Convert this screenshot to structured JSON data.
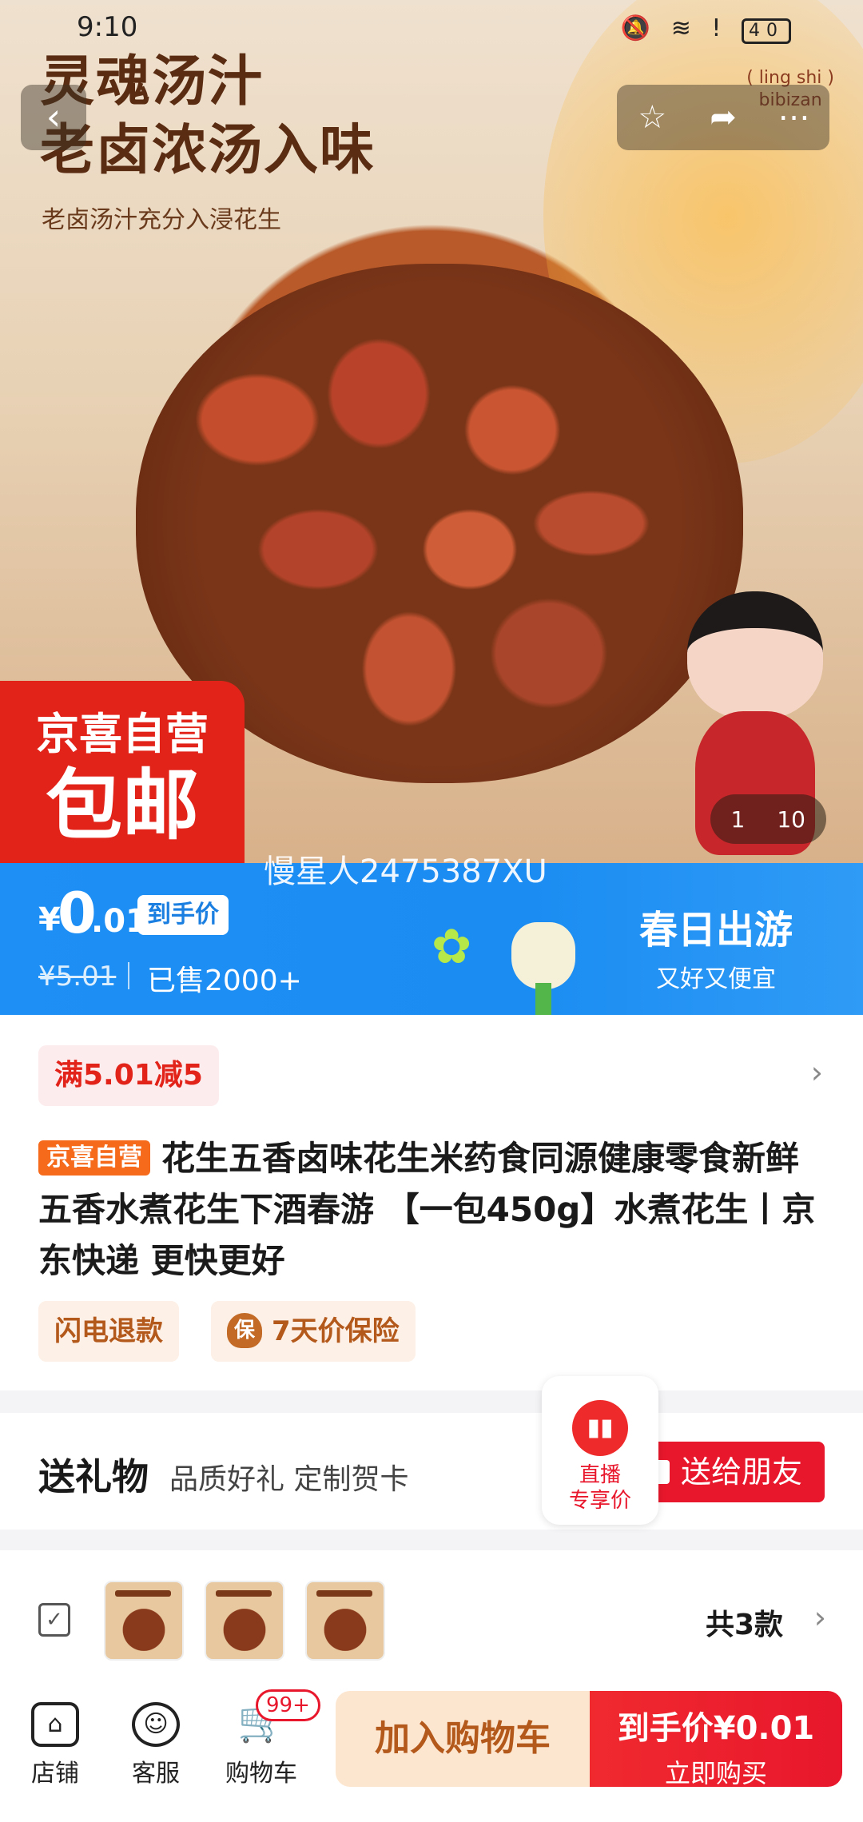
{
  "status_bar": {
    "time": "9:10",
    "battery": "40"
  },
  "hero": {
    "title_line1": "灵魂汤汁",
    "title_line2": "老卤浓汤入味",
    "subtitle": "老卤汤汁充分入浸花生",
    "brand_line1": "( ling shi )",
    "brand_line2": "bibizan",
    "badge_line1": "京喜自营",
    "badge_line2": "包邮",
    "pager_current": "1",
    "pager_total": "10"
  },
  "watermark": "慢星人2475387XU",
  "price": {
    "currency": "¥",
    "integer": "0",
    "decimal": ".01",
    "tag": "到手价",
    "original": "¥5.01",
    "sold": "已售2000+",
    "promo_title": "春日出游",
    "promo_sub": "又好又便宜"
  },
  "coupon": {
    "label": "满5.01减5"
  },
  "product": {
    "self_tag": "京喜自营",
    "title": "花生五香卤味花生米药食同源健康零食新鲜五香水煮花生下酒春游 【一包450g】水煮花生丨京东快递 更快更好",
    "chip1": "闪电退款",
    "chip2_icon": "保",
    "chip2": "7天价保险"
  },
  "gift": {
    "title": "送礼物",
    "subtitle": "品质好礼 定制贺卡",
    "button": "送给朋友"
  },
  "live": {
    "line1": "直播",
    "line2": "专享价"
  },
  "variants": {
    "count_label": "共3款"
  },
  "bottom_bar": {
    "shop": "店铺",
    "service": "客服",
    "cart": "购物车",
    "cart_badge": "99+",
    "add_to_cart": "加入购物车",
    "buy_price": "到手价¥0.01",
    "buy_now": "立即购买"
  },
  "colors": {
    "accent_red": "#e8172c",
    "price_blue": "#1e8ff5",
    "orange_tag": "#f56a1b"
  }
}
